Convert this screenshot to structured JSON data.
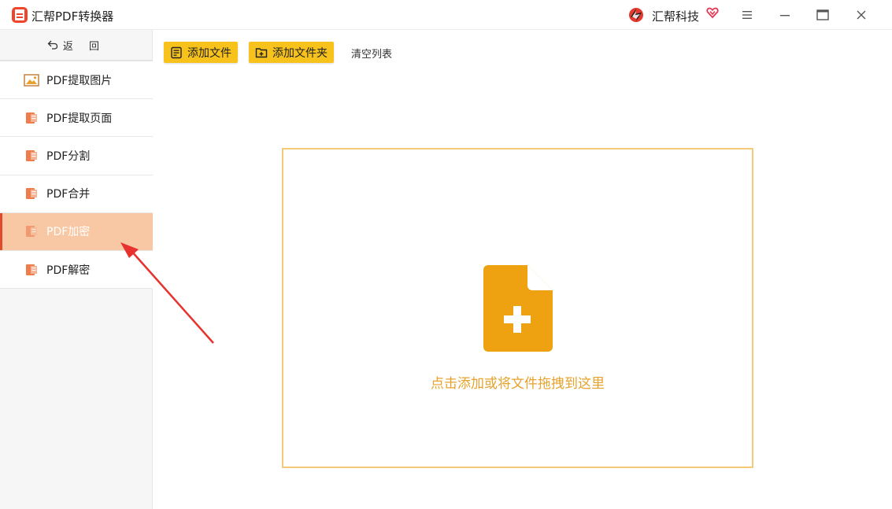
{
  "app": {
    "title": "汇帮PDF转换器",
    "brand_name": "汇帮科技",
    "accent": "#f7c21c",
    "active_color": "#f8c8a4",
    "hint_color": "#e6a22c"
  },
  "window_controls": {
    "menu": "menu-icon",
    "minimize": "minimize-icon",
    "maximize": "maximize-icon",
    "close": "close-icon"
  },
  "sidebar": {
    "back_label": "返 回",
    "items": [
      {
        "label": "PDF提取图片",
        "icon": "image-icon",
        "active": false
      },
      {
        "label": "PDF提取页面",
        "icon": "pdf-doc-icon",
        "active": false
      },
      {
        "label": "PDF分割",
        "icon": "pdf-doc-icon",
        "active": false
      },
      {
        "label": "PDF合并",
        "icon": "pdf-doc-icon",
        "active": false
      },
      {
        "label": "PDF加密",
        "icon": "pdf-doc-icon",
        "active": true
      },
      {
        "label": "PDF解密",
        "icon": "pdf-doc-icon",
        "active": false
      }
    ]
  },
  "toolbar": {
    "add_file_label": "添加文件",
    "add_folder_label": "添加文件夹",
    "clear_list_label": "清空列表"
  },
  "dropzone": {
    "hint": "点击添加或将文件拖拽到这里",
    "icon": "add-file-icon"
  }
}
